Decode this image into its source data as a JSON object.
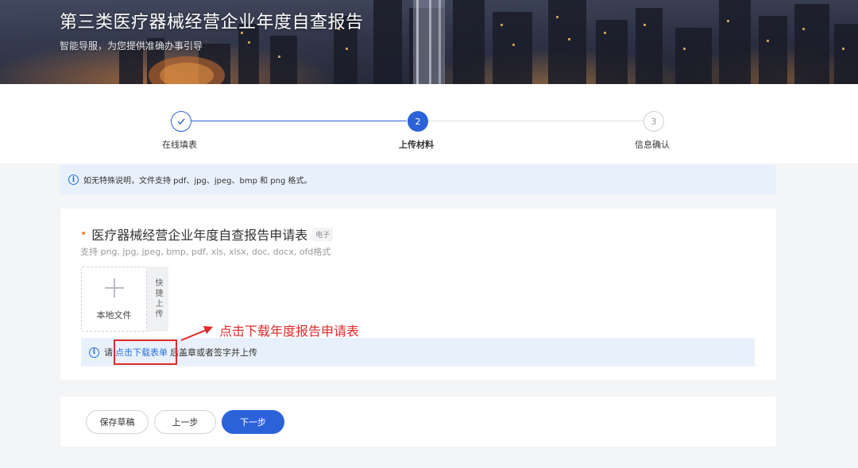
{
  "banner": {
    "title": "第三类医疗器械经营企业年度自查报告",
    "subtitle": "智能导服，为您提供准确办事引导"
  },
  "steps": [
    {
      "label": "在线填表",
      "state": "done",
      "symbol": "✓"
    },
    {
      "label": "上传材料",
      "state": "active",
      "symbol": "2"
    },
    {
      "label": "信息确认",
      "state": "pending",
      "symbol": "3"
    }
  ],
  "notice": {
    "text": "如无特殊说明，文件支持 pdf、jpg、jpeg、bmp 和 png 格式。"
  },
  "upload_field": {
    "required_mark": "•",
    "title": "医疗器械经营企业年度自查报告申请表",
    "tag": "电子",
    "formats": "支持 png, jpg, jpeg, bmp, pdf, xls, xlsx, doc, docx, ofd格式",
    "local_file_label": "本地文件",
    "quick_upload_label": "快捷上传",
    "hint_prefix": "请",
    "hint_link": "点击下载表单",
    "hint_suffix": "后盖章或者签字并上传"
  },
  "annotation": {
    "text": "点击下载年度报告申请表"
  },
  "footer": {
    "save_draft": "保存草稿",
    "prev": "上一步",
    "next": "下一步"
  },
  "colors": {
    "primary": "#2b62d9",
    "link": "#2b6fd6",
    "annotation": "#e02a2a",
    "required": "#f08a3c",
    "info_bg": "#e8f1fb"
  }
}
